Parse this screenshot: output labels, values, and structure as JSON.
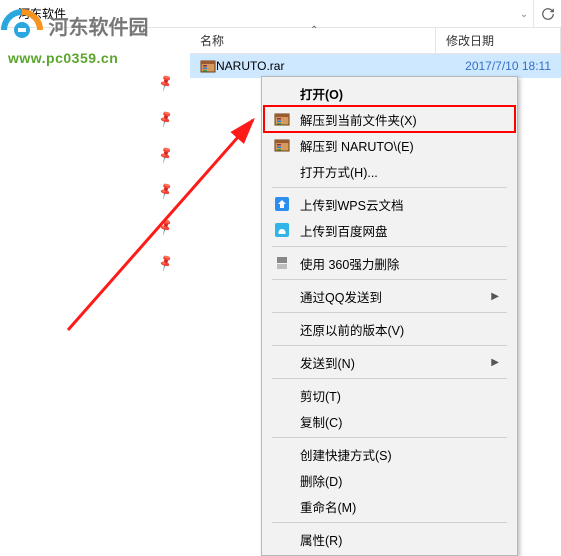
{
  "breadcrumb": {
    "chevron": "›",
    "folder": "河东软件",
    "dropdown_glyph": "⌄",
    "refresh_glyph": "⟳"
  },
  "columns": {
    "name": "名称",
    "sort_glyph": "⌃",
    "date": "修改日期"
  },
  "file": {
    "name": "NARUTO.rar",
    "date": "2017/7/10 18:11"
  },
  "pins": [
    "📌",
    "📌",
    "📌",
    "📌",
    "📌",
    "📌"
  ],
  "watermark": {
    "title": "河东软件园",
    "url": "www.pc0359.cn"
  },
  "menu": {
    "open": "打开(O)",
    "extract_here": "解压到当前文件夹(X)",
    "extract_to": "解压到 NARUTO\\(E)",
    "open_with": "打开方式(H)...",
    "wps": "上传到WPS云文档",
    "baidu": "上传到百度网盘",
    "shred360": "使用 360强力删除",
    "qq_send": "通过QQ发送到",
    "prev_versions": "还原以前的版本(V)",
    "send_to": "发送到(N)",
    "cut": "剪切(T)",
    "copy": "复制(C)",
    "shortcut": "创建快捷方式(S)",
    "delete": "删除(D)",
    "rename": "重命名(M)",
    "properties": "属性(R)",
    "arrow": "▶"
  }
}
